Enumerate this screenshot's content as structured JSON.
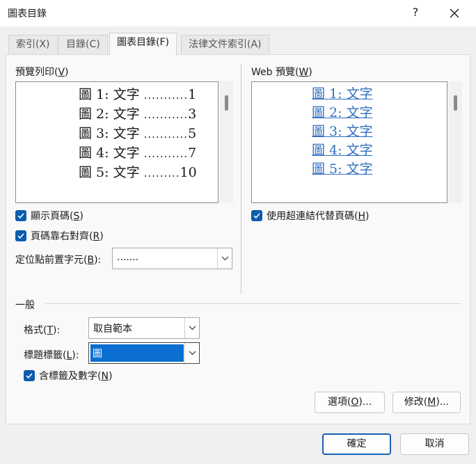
{
  "window": {
    "title": "圖表目錄",
    "help_label": "?",
    "close_label": "✕"
  },
  "tabs": [
    {
      "label": "索引(X)"
    },
    {
      "label": "目錄(C)"
    },
    {
      "label": "圖表目錄(F)"
    },
    {
      "label": "法律文件索引(A)"
    }
  ],
  "print_preview": {
    "label_main": "預覽列印(",
    "label_key": "V",
    "label_end": ")",
    "rows": [
      {
        "caption": "圖 1: 文字",
        "leader": "...........",
        "page": "1"
      },
      {
        "caption": "圖 2: 文字",
        "leader": "...........",
        "page": "3"
      },
      {
        "caption": "圖 3: 文字",
        "leader": "...........",
        "page": "5"
      },
      {
        "caption": "圖 4: 文字",
        "leader": "...........",
        "page": "7"
      },
      {
        "caption": "圖 5: 文字",
        "leader": ".........",
        "page": "10"
      }
    ]
  },
  "web_preview": {
    "label_main": "Web 預覽(",
    "label_key": "W",
    "label_end": ")",
    "links": [
      "圖 1: 文字",
      "圖 2: 文字",
      "圖 3: 文字",
      "圖 4: 文字",
      "圖 5: 文字"
    ]
  },
  "options": {
    "show_page_numbers": {
      "label": "顯示頁碼(",
      "key": "S",
      "end": ")",
      "checked": true
    },
    "right_align": {
      "label": "頁碼靠右對齊(",
      "key": "R",
      "end": ")",
      "checked": true
    },
    "tab_leader": {
      "label": "定位點前置字元(",
      "key": "B",
      "end": "):",
      "value": "......."
    },
    "use_hyperlinks": {
      "label": "使用超連結代替頁碼(",
      "key": "H",
      "end": ")",
      "checked": true
    }
  },
  "general": {
    "heading": "一般",
    "format": {
      "label": "格式(",
      "key": "T",
      "end": "):",
      "value": "取自範本"
    },
    "caption_label": {
      "label": "標題標籤(",
      "key": "L",
      "end": "):",
      "value": "圖"
    },
    "include_label": {
      "label": "含標籤及數字(",
      "key": "N",
      "end": ")",
      "checked": true
    }
  },
  "buttons": {
    "options": {
      "label": "選項(",
      "key": "O",
      "end": ")..."
    },
    "modify": {
      "label": "修改(",
      "key": "M",
      "end": ")..."
    },
    "ok": "確定",
    "cancel": "取消"
  },
  "colors": {
    "accent": "#0b5cad",
    "link": "#2f6fbf",
    "selection": "#0a6fd0"
  }
}
